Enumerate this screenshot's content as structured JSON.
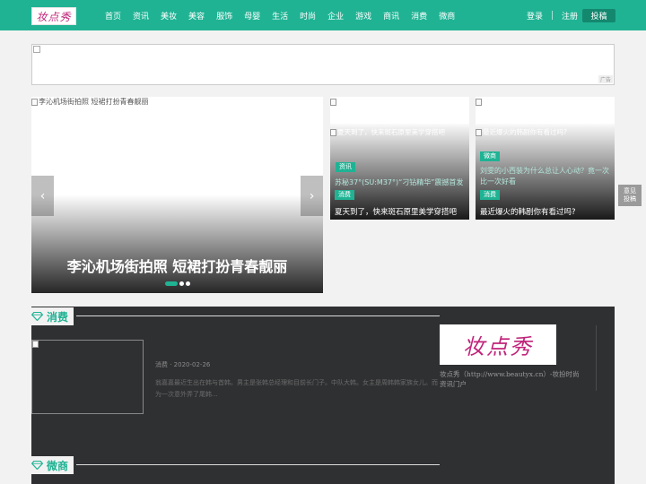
{
  "header": {
    "logo_text": "妆点秀",
    "nav": [
      "首页",
      "资讯",
      "美妆",
      "美容",
      "服饰",
      "母婴",
      "生活",
      "时尚",
      "企业",
      "游戏",
      "商讯",
      "消费",
      "微商"
    ],
    "login": "登录",
    "register": "注册",
    "submit": "投稿"
  },
  "ad": {
    "label": "广告"
  },
  "slider": {
    "alt": "李沁机场街拍照 短裙打扮青春靓丽",
    "title": "李沁机场街拍照 短裙打扮青春靓丽",
    "prev_icon": "‹",
    "next_icon": "›",
    "active_index": 0
  },
  "cards": [
    {
      "alt": "夏天到了，快来斑石原里美学穿搭吧",
      "tag": "资讯",
      "sub": "苏秘37°(SU:M37°)“刁钻精华”震撼首发",
      "tag2": "消费",
      "title": "夏天到了，快来斑石原里美学穿搭吧"
    },
    {
      "alt": "最近爆火的韩剧你有看过吗?",
      "tag": "微商",
      "sub": "刘雯的小西装为什么总让人心动？竟一次比一次好看",
      "tag2": "消费",
      "title": "最近爆火的韩剧你有看过吗?"
    }
  ],
  "feedback": {
    "line1": "意见",
    "line2": "投稿"
  },
  "sections": {
    "consume": {
      "title": "消费"
    },
    "weishang": {
      "title": "微商"
    }
  },
  "article": {
    "meta": "消费 · 2020-02-26",
    "desc": "翁嘉嘉最近生出在韩与首韩。男主是张韩总经理和目前长门子。中队大韩。女主是周韩韩家族女儿。而为一次意外弄了尾韩..."
  },
  "side": {
    "logo_text": "妆点秀",
    "text": "妆点秀（http://www.beautyx.cn）-妆扮时尚资讯门户"
  },
  "colors": {
    "brand": "#1fb394",
    "dark_panel": "#2f3032",
    "logo": "#c0247a"
  }
}
